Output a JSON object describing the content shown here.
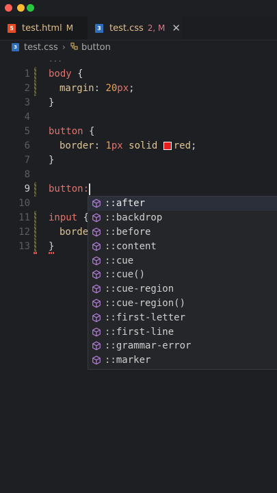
{
  "window": {
    "controls": [
      "close",
      "minimize",
      "zoom"
    ]
  },
  "tabs": [
    {
      "icon": "html5-icon",
      "icon_text": "5",
      "name": "test.html",
      "status": "M"
    },
    {
      "icon": "css3-icon",
      "icon_text": "3",
      "name": "test.css",
      "status": "2, M",
      "close": "✕"
    }
  ],
  "breadcrumb": {
    "file": "test.css",
    "separator": "›",
    "symbol_icon": "symbol-class-icon",
    "symbol": "button"
  },
  "editor": {
    "ellipsis": "...",
    "line_numbers": [
      "1",
      "2",
      "3",
      "4",
      "5",
      "6",
      "7",
      "8",
      "9",
      "10",
      "11",
      "12",
      "13"
    ],
    "current_line": "9",
    "lines": {
      "l1": {
        "selector": "body",
        "brace": " {"
      },
      "l2": {
        "prop": "margin",
        "colon": ": ",
        "num": "20",
        "unit": "px",
        "semi": ";"
      },
      "l3": {
        "close": "}"
      },
      "l5": {
        "selector": "button",
        "brace": " {"
      },
      "l6": {
        "prop": "border",
        "colon": ": ",
        "num": "1",
        "unit": "px",
        "rest": " solid ",
        "value": "red",
        "semi": ";"
      },
      "l7": {
        "close": "}"
      },
      "l9": {
        "selector": "button",
        "colon": ":"
      },
      "l11": {
        "selector": "input",
        "brace": " {"
      },
      "l12": {
        "prop": "borde"
      },
      "l13": {
        "close": "}"
      }
    },
    "swatch_color": "#e51f1f"
  },
  "suggestions": [
    "::after",
    "::backdrop",
    "::before",
    "::content",
    "::cue",
    "::cue()",
    "::cue-region",
    "::cue-region()",
    "::first-letter",
    "::first-line",
    "::grammar-error",
    "::marker"
  ],
  "suggestion_icon": "property-cube-icon",
  "colors": {
    "background": "#1e1f22",
    "selector": "#e5726b",
    "property": "#dcc596",
    "number": "#e6a15a",
    "cube_icon": "#b180d7"
  }
}
